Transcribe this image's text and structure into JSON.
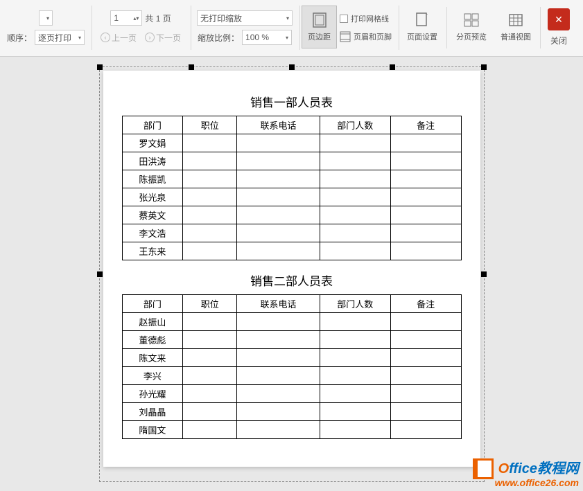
{
  "toolbar": {
    "order_label": "顺序：",
    "order_value": "逐页打印",
    "page_input": "1",
    "page_total": "共 1 页",
    "prev_page": "上一页",
    "next_page": "下一页",
    "scale_mode": "无打印缩放",
    "scale_label": "缩放比例：",
    "scale_value": "100 %",
    "margins": "页边距",
    "gridlines": "打印网格线",
    "header_footer": "页眉和页脚",
    "page_setup": "页面设置",
    "page_break": "分页预览",
    "normal_view": "普通视图",
    "close": "关闭"
  },
  "doc": {
    "title1": "销售一部人员表",
    "title2": "销售二部人员表",
    "headers": [
      "部门",
      "职位",
      "联系电话",
      "部门人数",
      "备注"
    ],
    "table1_rows": [
      "罗文娟",
      "田洪涛",
      "陈振凯",
      "张光泉",
      "蔡英文",
      "李文浩",
      "王东来"
    ],
    "table2_rows": [
      "赵振山",
      "董德彪",
      "陈文来",
      "李兴",
      "孙光耀",
      "刘晶晶",
      "隋国文"
    ]
  },
  "watermark": {
    "line1_a": "O",
    "line1_b": "ffice教程网",
    "line2": "www.office26.com"
  }
}
